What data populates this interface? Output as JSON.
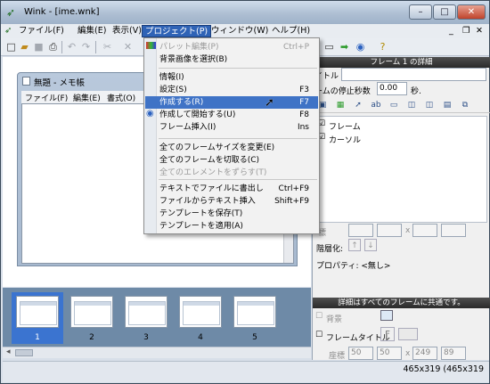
{
  "window": {
    "title": "Wink - [ime.wnk]",
    "min": "–",
    "max": "□",
    "close": "✕"
  },
  "menubar": {
    "items": [
      "ファイル(F)",
      "編集(E)",
      "表示(V)",
      "プロジェクト(P)",
      "ウィンドウ(W)",
      "ヘルプ(H)"
    ],
    "mdi_min": "_",
    "mdi_restore": "❐",
    "mdi_close": "✕"
  },
  "dropdown": {
    "groups": [
      [
        {
          "label": "パレット編集(P)",
          "shortcut": "Ctrl+P",
          "disabled": true
        },
        {
          "label": "背景画像を選択(B)",
          "shortcut": ""
        }
      ],
      [
        {
          "label": "情報(I)",
          "shortcut": ""
        },
        {
          "label": "設定(S)",
          "shortcut": "F3"
        },
        {
          "label": "作成する(R)",
          "shortcut": "F7",
          "highlight": true
        },
        {
          "label": "作成して開始する(U)",
          "shortcut": "F8"
        },
        {
          "label": "フレーム挿入(I)",
          "shortcut": "Ins"
        }
      ],
      [
        {
          "label": "全てのフレームサイズを変更(E)",
          "shortcut": ""
        },
        {
          "label": "全てのフレームを切取る(C)",
          "shortcut": ""
        },
        {
          "label": "全てのエレメントをずらす(T)",
          "shortcut": "",
          "disabled": true
        }
      ],
      [
        {
          "label": "テキストでファイルに書出し",
          "shortcut": "Ctrl+F9"
        },
        {
          "label": "ファイルからテキスト挿入",
          "shortcut": "Shift+F9"
        },
        {
          "label": "テンプレートを保存(T)",
          "shortcut": ""
        },
        {
          "label": "テンプレートを適用(A)",
          "shortcut": ""
        }
      ]
    ]
  },
  "notepad": {
    "title": "無題 - メモ帳",
    "menu": [
      "ファイル(F)",
      "編集(E)",
      "書式(O)"
    ]
  },
  "filmstrip": {
    "frames": [
      "1",
      "2",
      "3",
      "4",
      "5"
    ],
    "selected": 0
  },
  "panel": {
    "header": "フレーム 1 の詳細",
    "title_label": "イトル",
    "stop_label": "ームの停止秒数",
    "stop_value": "0.00",
    "stop_unit": "秒.",
    "tree": [
      "フレーム",
      "カーソル"
    ],
    "coord_label": "標",
    "coord_x": "x",
    "layer_label": "階層化:",
    "prop_label": "プロパティ: <無し>",
    "all_header": "詳細はすべてのフレームに共通です。",
    "bg_label": "背景",
    "frame_title_label": "フレームタイトル",
    "font_btn": "F",
    "coords_label": "座標",
    "c_left": "50",
    "c_top": "50",
    "c_x": "x",
    "c_w": "249",
    "c_h": "89"
  },
  "status": {
    "text": "465x319 (465x319"
  },
  "colors": {
    "menu_highlight": "#3f73c6",
    "selected_frame": "#3b74d0"
  }
}
